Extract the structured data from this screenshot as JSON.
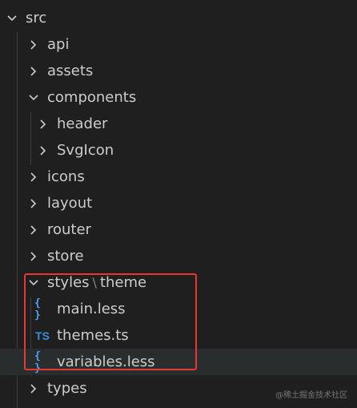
{
  "explorer": {
    "root": {
      "label": "src",
      "expanded": true
    },
    "folders": {
      "api": "api",
      "assets": "assets",
      "components": "components",
      "header": "header",
      "svgicon": "SvgIcon",
      "icons": "icons",
      "layout": "layout",
      "router": "router",
      "store": "store",
      "styles": "styles",
      "styles_sep": "\\",
      "theme": "theme",
      "types": "types"
    },
    "files": {
      "main_less": {
        "label": "main.less",
        "icon": "{ }"
      },
      "themes_ts": {
        "label": "themes.ts",
        "icon": "TS"
      },
      "variables_less": {
        "label": "variables.less",
        "icon": "{ }"
      }
    },
    "selected": "variables.less"
  },
  "annotation": {
    "highlight_color": "#e53935"
  },
  "watermark": "@稀土掘金技术社区"
}
